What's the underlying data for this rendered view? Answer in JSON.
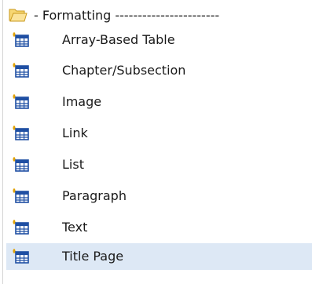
{
  "tree": {
    "folder": {
      "label": "- Formatting -----------------------",
      "icon": "folder-open-icon",
      "icon_color": "#f2c94c"
    },
    "items": [
      {
        "label": "Array-Based Table",
        "icon": "table-icon",
        "selected": false
      },
      {
        "label": "Chapter/Subsection",
        "icon": "table-icon",
        "selected": false
      },
      {
        "label": "Image",
        "icon": "table-icon",
        "selected": false
      },
      {
        "label": "Link",
        "icon": "table-icon",
        "selected": false
      },
      {
        "label": "List",
        "icon": "table-icon",
        "selected": false
      },
      {
        "label": "Paragraph",
        "icon": "table-icon",
        "selected": false
      },
      {
        "label": "Text",
        "icon": "table-icon",
        "selected": false
      },
      {
        "label": "Title Page",
        "icon": "table-icon",
        "selected": true
      }
    ],
    "colors": {
      "selection": "#dde8f5",
      "table_icon": "#1f4fa3",
      "table_icon_sparkle": "#e0a000"
    }
  }
}
